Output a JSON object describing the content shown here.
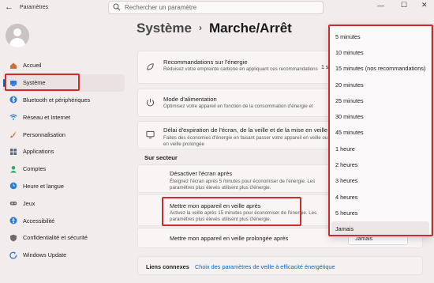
{
  "app": {
    "title": "Paramètres"
  },
  "search": {
    "placeholder": "Rechercher un paramètre"
  },
  "sidebar": {
    "items": [
      {
        "label": "Accueil",
        "icon": "home-icon",
        "color": "#c9703c"
      },
      {
        "label": "Système",
        "icon": "system-icon",
        "color": "#2b7bd3",
        "active": true
      },
      {
        "label": "Bluetooth et périphériques",
        "icon": "bluetooth-icon",
        "color": "#2b7bd3"
      },
      {
        "label": "Réseau et Internet",
        "icon": "wifi-icon",
        "color": "#2b7bd3"
      },
      {
        "label": "Personnalisation",
        "icon": "brush-icon",
        "color": "#c9703c"
      },
      {
        "label": "Applications",
        "icon": "apps-icon",
        "color": "#5a6a85"
      },
      {
        "label": "Comptes",
        "icon": "account-icon",
        "color": "#2eaa6a"
      },
      {
        "label": "Heure et langue",
        "icon": "globe-clock-icon",
        "color": "#2b7bd3"
      },
      {
        "label": "Jeux",
        "icon": "gamepad-icon",
        "color": "#6b6b6b"
      },
      {
        "label": "Accessibilité",
        "icon": "accessibility-icon",
        "color": "#2b7bd3"
      },
      {
        "label": "Confidentialité et sécurité",
        "icon": "shield-icon",
        "color": "#6b6b6b"
      },
      {
        "label": "Windows Update",
        "icon": "update-icon",
        "color": "#2b7bd3"
      }
    ]
  },
  "breadcrumb": {
    "parent": "Système",
    "current": "Marche/Arrêt"
  },
  "cards": {
    "recommendations": {
      "title": "Recommandations sur l'énergie",
      "desc": "Réduisez votre empreinte carbone en appliquant ces recommandations",
      "side": "1 s"
    },
    "power_mode": {
      "title": "Mode d'alimentation",
      "desc": "Optimisez votre appareil en fonction de la consommation d'énergie et"
    },
    "timeout": {
      "title": "Délai d'expiration de l'écran, de la veille et de la mise en veille",
      "desc": "Faites des économies d'énergie en faisant passer votre appareil en veille ou en mise en veille prolongée"
    }
  },
  "section": {
    "label": "Sur secteur"
  },
  "settings": {
    "screen_off": {
      "title": "Désactiver l'écran après",
      "desc": "Éteignez l'écran après 5 minutes pour économiser de l'énergie. Les paramètres plus élevés utilisent plus d'énergie."
    },
    "sleep": {
      "title": "Mettre mon appareil en veille après",
      "desc": "Activez la veille après 15 minutes pour économiser de l'énergie. Les paramètres plus élevés utilisent plus d'énergie."
    },
    "hibernate": {
      "title": "Mettre mon appareil en veille prolongée après",
      "value": "Jamais"
    }
  },
  "footer": {
    "label": "Liens connexes",
    "link": "Choix des paramètres de veille à efficacité énergétique"
  },
  "dropdown": {
    "options": [
      "5 minutes",
      "10 minutes",
      "15 minutes (nos recommandations)",
      "20 minutes",
      "25 minutes",
      "30 minutes",
      "45 minutes",
      "1 heure",
      "2 heures",
      "3 heures",
      "4 heures",
      "5 heures",
      "Jamais"
    ],
    "selected": "Jamais"
  },
  "colors": {
    "highlight": "#d02b2b",
    "accent": "#0067c0"
  }
}
